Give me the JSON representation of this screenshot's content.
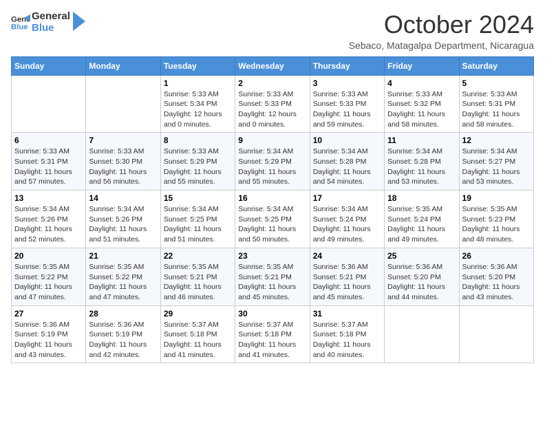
{
  "header": {
    "logo": {
      "general": "General",
      "blue": "Blue"
    },
    "title": "October 2024",
    "subtitle": "Sebaco, Matagalpa Department, Nicaragua"
  },
  "calendar": {
    "days_of_week": [
      "Sunday",
      "Monday",
      "Tuesday",
      "Wednesday",
      "Thursday",
      "Friday",
      "Saturday"
    ],
    "weeks": [
      [
        {
          "day": "",
          "info": ""
        },
        {
          "day": "",
          "info": ""
        },
        {
          "day": "1",
          "info": "Sunrise: 5:33 AM\nSunset: 5:34 PM\nDaylight: 12 hours\nand 0 minutes."
        },
        {
          "day": "2",
          "info": "Sunrise: 5:33 AM\nSunset: 5:33 PM\nDaylight: 12 hours\nand 0 minutes."
        },
        {
          "day": "3",
          "info": "Sunrise: 5:33 AM\nSunset: 5:33 PM\nDaylight: 11 hours\nand 59 minutes."
        },
        {
          "day": "4",
          "info": "Sunrise: 5:33 AM\nSunset: 5:32 PM\nDaylight: 11 hours\nand 58 minutes."
        },
        {
          "day": "5",
          "info": "Sunrise: 5:33 AM\nSunset: 5:31 PM\nDaylight: 11 hours\nand 58 minutes."
        }
      ],
      [
        {
          "day": "6",
          "info": "Sunrise: 5:33 AM\nSunset: 5:31 PM\nDaylight: 11 hours\nand 57 minutes."
        },
        {
          "day": "7",
          "info": "Sunrise: 5:33 AM\nSunset: 5:30 PM\nDaylight: 11 hours\nand 56 minutes."
        },
        {
          "day": "8",
          "info": "Sunrise: 5:33 AM\nSunset: 5:29 PM\nDaylight: 11 hours\nand 55 minutes."
        },
        {
          "day": "9",
          "info": "Sunrise: 5:34 AM\nSunset: 5:29 PM\nDaylight: 11 hours\nand 55 minutes."
        },
        {
          "day": "10",
          "info": "Sunrise: 5:34 AM\nSunset: 5:28 PM\nDaylight: 11 hours\nand 54 minutes."
        },
        {
          "day": "11",
          "info": "Sunrise: 5:34 AM\nSunset: 5:28 PM\nDaylight: 11 hours\nand 53 minutes."
        },
        {
          "day": "12",
          "info": "Sunrise: 5:34 AM\nSunset: 5:27 PM\nDaylight: 11 hours\nand 53 minutes."
        }
      ],
      [
        {
          "day": "13",
          "info": "Sunrise: 5:34 AM\nSunset: 5:26 PM\nDaylight: 11 hours\nand 52 minutes."
        },
        {
          "day": "14",
          "info": "Sunrise: 5:34 AM\nSunset: 5:26 PM\nDaylight: 11 hours\nand 51 minutes."
        },
        {
          "day": "15",
          "info": "Sunrise: 5:34 AM\nSunset: 5:25 PM\nDaylight: 11 hours\nand 51 minutes."
        },
        {
          "day": "16",
          "info": "Sunrise: 5:34 AM\nSunset: 5:25 PM\nDaylight: 11 hours\nand 50 minutes."
        },
        {
          "day": "17",
          "info": "Sunrise: 5:34 AM\nSunset: 5:24 PM\nDaylight: 11 hours\nand 49 minutes."
        },
        {
          "day": "18",
          "info": "Sunrise: 5:35 AM\nSunset: 5:24 PM\nDaylight: 11 hours\nand 49 minutes."
        },
        {
          "day": "19",
          "info": "Sunrise: 5:35 AM\nSunset: 5:23 PM\nDaylight: 11 hours\nand 48 minutes."
        }
      ],
      [
        {
          "day": "20",
          "info": "Sunrise: 5:35 AM\nSunset: 5:22 PM\nDaylight: 11 hours\nand 47 minutes."
        },
        {
          "day": "21",
          "info": "Sunrise: 5:35 AM\nSunset: 5:22 PM\nDaylight: 11 hours\nand 47 minutes."
        },
        {
          "day": "22",
          "info": "Sunrise: 5:35 AM\nSunset: 5:21 PM\nDaylight: 11 hours\nand 46 minutes."
        },
        {
          "day": "23",
          "info": "Sunrise: 5:35 AM\nSunset: 5:21 PM\nDaylight: 11 hours\nand 45 minutes."
        },
        {
          "day": "24",
          "info": "Sunrise: 5:36 AM\nSunset: 5:21 PM\nDaylight: 11 hours\nand 45 minutes."
        },
        {
          "day": "25",
          "info": "Sunrise: 5:36 AM\nSunset: 5:20 PM\nDaylight: 11 hours\nand 44 minutes."
        },
        {
          "day": "26",
          "info": "Sunrise: 5:36 AM\nSunset: 5:20 PM\nDaylight: 11 hours\nand 43 minutes."
        }
      ],
      [
        {
          "day": "27",
          "info": "Sunrise: 5:36 AM\nSunset: 5:19 PM\nDaylight: 11 hours\nand 43 minutes."
        },
        {
          "day": "28",
          "info": "Sunrise: 5:36 AM\nSunset: 5:19 PM\nDaylight: 11 hours\nand 42 minutes."
        },
        {
          "day": "29",
          "info": "Sunrise: 5:37 AM\nSunset: 5:18 PM\nDaylight: 11 hours\nand 41 minutes."
        },
        {
          "day": "30",
          "info": "Sunrise: 5:37 AM\nSunset: 5:18 PM\nDaylight: 11 hours\nand 41 minutes."
        },
        {
          "day": "31",
          "info": "Sunrise: 5:37 AM\nSunset: 5:18 PM\nDaylight: 11 hours\nand 40 minutes."
        },
        {
          "day": "",
          "info": ""
        },
        {
          "day": "",
          "info": ""
        }
      ]
    ]
  }
}
